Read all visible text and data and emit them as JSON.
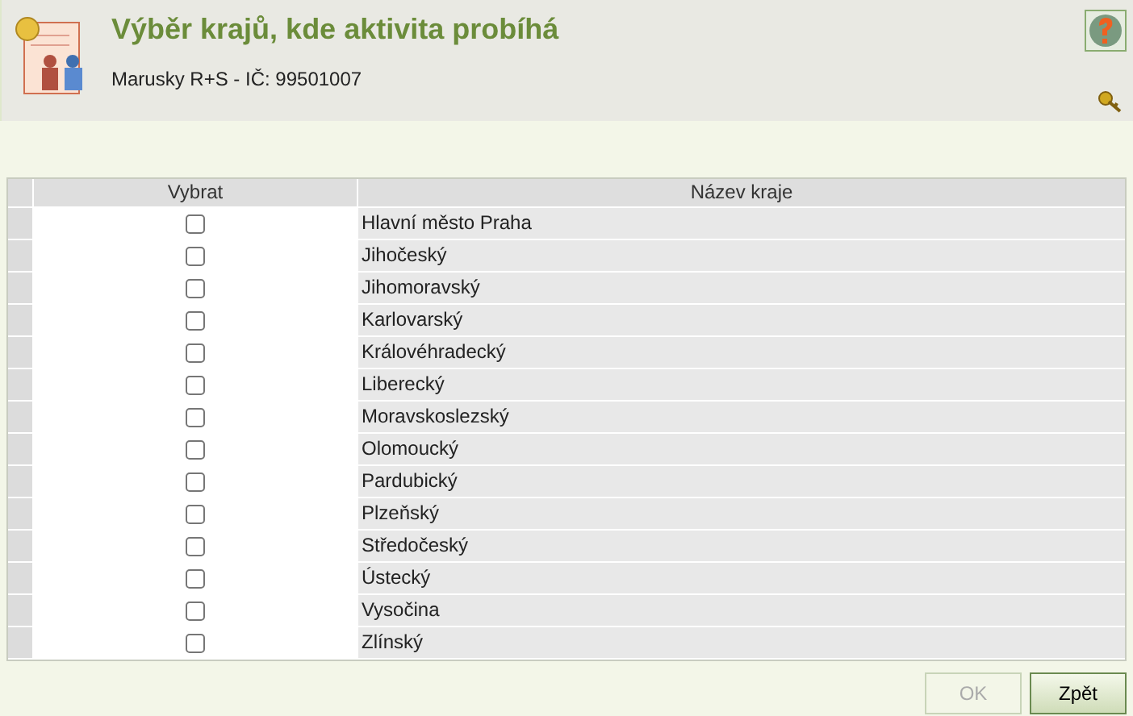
{
  "header": {
    "title": "Výběr krajů, kde aktivita probíhá",
    "subtitle": "Marusky R+S - IČ: 99501007"
  },
  "table": {
    "columns": [
      "Vybrat",
      "Název kraje"
    ],
    "rows": [
      {
        "name": "Hlavní město Praha",
        "checked": false
      },
      {
        "name": "Jihočeský",
        "checked": false
      },
      {
        "name": "Jihomoravský",
        "checked": false
      },
      {
        "name": "Karlovarský",
        "checked": false
      },
      {
        "name": "Královéhradecký",
        "checked": false
      },
      {
        "name": "Liberecký",
        "checked": false
      },
      {
        "name": "Moravskoslezský",
        "checked": false
      },
      {
        "name": "Olomoucký",
        "checked": false
      },
      {
        "name": "Pardubický",
        "checked": false
      },
      {
        "name": "Plzeňský",
        "checked": false
      },
      {
        "name": "Středočeský",
        "checked": false
      },
      {
        "name": "Ústecký",
        "checked": false
      },
      {
        "name": "Vysočina",
        "checked": false
      },
      {
        "name": "Zlínský",
        "checked": false
      }
    ]
  },
  "buttons": [
    {
      "label": "OK",
      "disabled": true
    },
    {
      "label": "Zpět",
      "disabled": false
    }
  ]
}
